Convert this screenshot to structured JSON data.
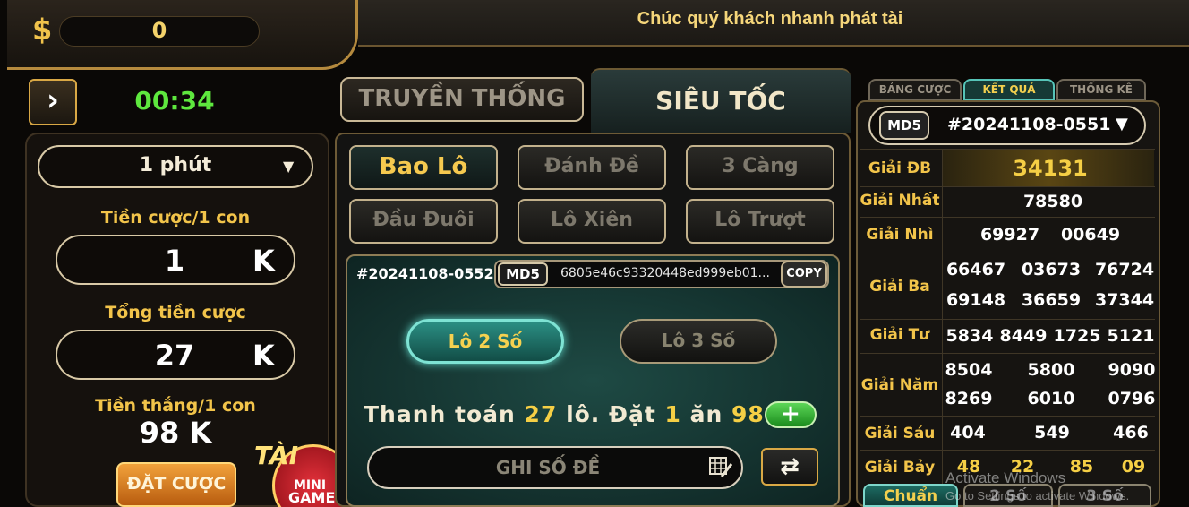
{
  "header": {
    "currency_symbol": "$",
    "balance": "0",
    "banner": "Chúc quý khách nhanh phát tài"
  },
  "left": {
    "timer": "00:34",
    "period": "1 phút",
    "bet_per_label": "Tiền cược/1 con",
    "bet_per_value": "1",
    "bet_per_unit": "K",
    "total_label": "Tổng tiền cược",
    "total_value": "27",
    "total_unit": "K",
    "win_label": "Tiền thắng/1 con",
    "win_value": "98 K",
    "place_bet": "ĐẶT CƯỢC",
    "mini_game_top": "TÀI",
    "mini_game_1": "MINI",
    "mini_game_2": "GAME"
  },
  "modes": {
    "classic": "TRUYỀN THỐNG",
    "fast": "SIÊU TỐC"
  },
  "bet_types": [
    "Bao Lô",
    "Đánh Đề",
    "3 Càng",
    "Đầu Đuôi",
    "Lô Xiên",
    "Lô Trượt"
  ],
  "ticket": {
    "draw_id": "#20241108-0552",
    "md5_label": "MD5",
    "md5_hash": "6805e46c93320448ed999eb01...",
    "copy": "COPY",
    "subtabs": [
      "Lô 2 Số",
      "Lô 3 Số"
    ],
    "payment_prefix": "Thanh toán",
    "payment_count": "27",
    "payment_mid": "lô. Đặt",
    "payment_stake": "1",
    "payment_word": "ăn",
    "payment_win": "98",
    "number_placeholder": "GHI SỐ ĐỀ"
  },
  "results": {
    "tabs": [
      "BẢNG CƯỢC",
      "KẾT QUẢ",
      "THỐNG KÊ"
    ],
    "md5_label": "MD5",
    "draw_id": "#20241108-0551",
    "prizes": {
      "db_name": "Giải ĐB",
      "db": "34131",
      "nhat_name": "Giải Nhất",
      "nhat": "78580",
      "nhi_name": "Giải Nhì",
      "nhi": [
        "69927",
        "00649"
      ],
      "ba_name": "Giải Ba",
      "ba": [
        "66467",
        "03673",
        "76724",
        "69148",
        "36659",
        "37344"
      ],
      "tu_name": "Giải Tư",
      "tu": [
        "5834",
        "8449",
        "1725",
        "5121"
      ],
      "nam_name": "Giải Năm",
      "nam": [
        "8504",
        "5800",
        "9090",
        "8269",
        "6010",
        "0796"
      ],
      "sau_name": "Giải Sáu",
      "sau": [
        "404",
        "549",
        "466"
      ],
      "bay_name": "Giải Bảy",
      "bay": [
        "48",
        "22",
        "85",
        "09"
      ]
    },
    "bottom_tabs": [
      "Chuẩn",
      "2 Số",
      "3 Số"
    ]
  },
  "watermark": {
    "line1": "Activate Windows",
    "line2": "Go to Settings to activate Windows."
  },
  "icons": {
    "arrow": "chevron-right-icon",
    "caret": "caret-down-icon",
    "plus": "plus-icon",
    "edit": "edit-grid-icon",
    "shuffle": "shuffle-icon"
  }
}
